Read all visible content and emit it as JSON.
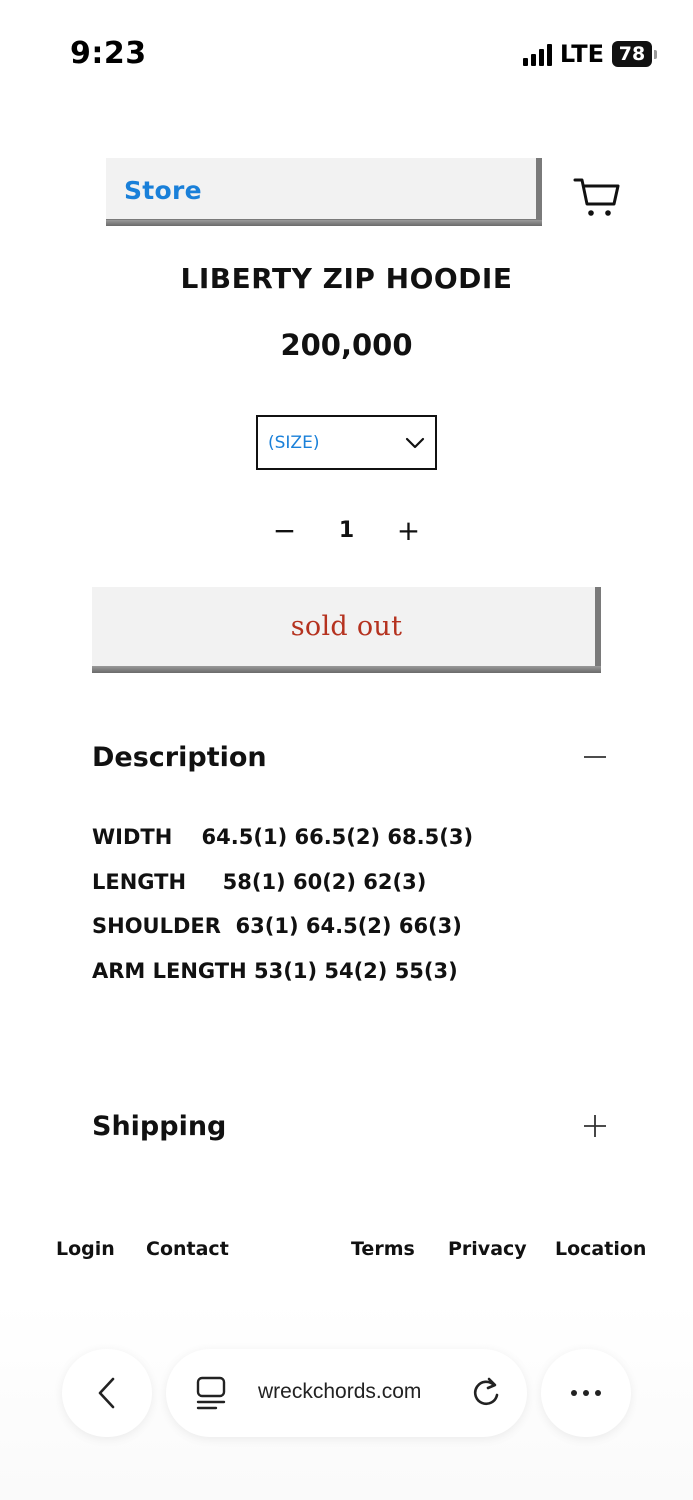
{
  "status_bar": {
    "time": "9:23",
    "network": "LTE",
    "battery": "78"
  },
  "header": {
    "store_label": "Store",
    "cart_icon": "cart-icon"
  },
  "product": {
    "title": "LIBERTY ZIP HOODIE",
    "price": "200,000",
    "size_select": {
      "selected": "(SIZE)"
    },
    "quantity": {
      "decrement": "−",
      "value": "1",
      "increment": "+"
    },
    "buy_button_label": "sold out"
  },
  "description": {
    "title": "Description",
    "toggle": "−",
    "specs": [
      "WIDTH    64.5(1) 66.5(2) 68.5(3)",
      "LENGTH     58(1) 60(2) 62(3)",
      "SHOULDER  63(1) 64.5(2) 66(3)",
      "ARM LENGTH 53(1) 54(2) 55(3)"
    ]
  },
  "shipping": {
    "title": "Shipping",
    "toggle": "+"
  },
  "footer": {
    "links": [
      "Login",
      "Contact",
      "Terms",
      "Privacy",
      "Location"
    ]
  },
  "browser": {
    "url": "wreckchords.com"
  },
  "colors": {
    "accent_blue": "#1a80d9",
    "sold_out_red": "#b5321f",
    "button_bg": "#f2f2f2"
  }
}
